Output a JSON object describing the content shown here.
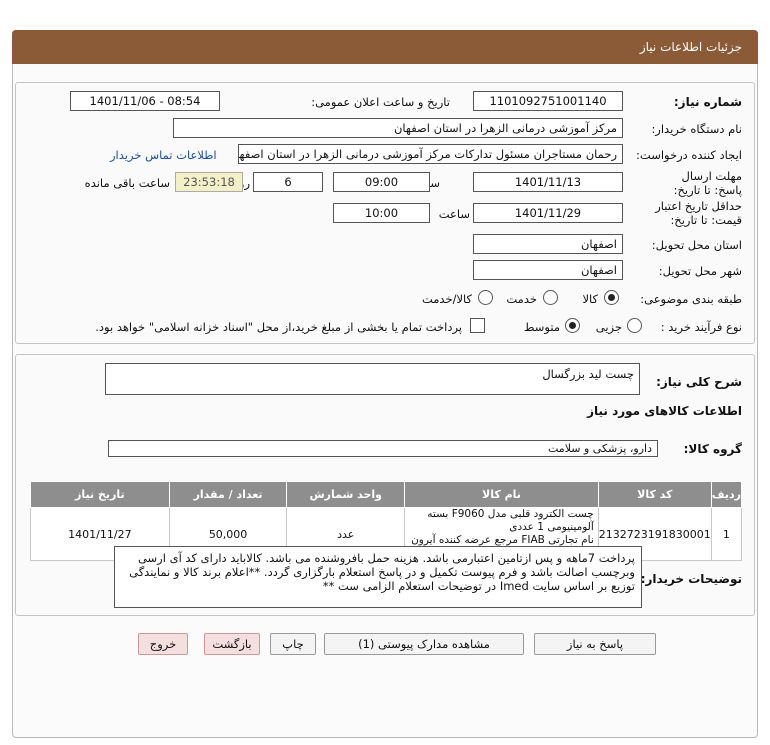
{
  "header": {
    "title": "جزئیات اطلاعات نیاز"
  },
  "form": {
    "need_number_label": "شماره نیاز:",
    "need_number_value": "1101092751001140",
    "announce_label": "تاریخ و ساعت اعلان عمومی:",
    "announce_value": "1401/11/06 - 08:54",
    "buyer_org_label": "نام دستگاه خریدار:",
    "buyer_org_value": "مرکز آموزشی درمانی الزهرا در استان اصفهان",
    "requester_label": "ایجاد کننده درخواست:",
    "requester_value": "رحمان مستاجران مسئول تداركات مرکز آموزشی درمانی الزهرا در استان اصفهان",
    "contact_link": "اطلاعات تماس خریدار",
    "deadline_label": "مهلت ارسال پاسخ: تا تاریخ:",
    "deadline_date": "1401/11/13",
    "time_label": "ساعت",
    "deadline_time": "09:00",
    "days_value": "6",
    "days_label": "روز و",
    "remaining_value": "23:53:18",
    "remaining_label": "ساعت باقی مانده",
    "validity_label": "حداقل تاریخ اعتبار قیمت: تا تاریخ:",
    "validity_date": "1401/11/29",
    "validity_time": "10:00",
    "province_label": "استان محل تحویل:",
    "province_value": "اصفهان",
    "city_label": "شهر محل تحویل:",
    "city_value": "اصفهان",
    "category_label": "طبقه بندی موضوعی:",
    "category_options": [
      "کالا",
      "خدمت",
      "کالا/خدمت"
    ],
    "category_selected": "کالا",
    "purchase_type_label": "نوع فرآیند خرید :",
    "purchase_options": [
      "جزیی",
      "متوسط"
    ],
    "purchase_selected": "متوسط",
    "payment_note": "پرداخت تمام یا بخشی از مبلغ خرید،از محل \"اسناد خزانه اسلامی\" خواهد بود."
  },
  "need": {
    "summary_label": "شرح کلی نیاز:",
    "summary_value": "چست لید بزرگسال",
    "goods_info_title": "اطلاعات کالاهای مورد نیاز",
    "goods_group_label": "گروه کالا:",
    "goods_group_value": "دارو، پزشکی و سلامت"
  },
  "table": {
    "headers": [
      "ردیف",
      "کد کالا",
      "نام کالا",
      "واحد شمارش",
      "تعداد / مقدار",
      "تاریخ نیاز"
    ],
    "rows": [
      {
        "index": "1",
        "code": "2132723191830001",
        "name_line1": "چست الکترود قلبی مدل F9060 بسته آلومینیومی 1 عددی",
        "name_line2": "نام تجارتی FIAB مرجع عرضه کننده آیرون نیلوفر",
        "unit": "عدد",
        "qty": "50,000",
        "date": "1401/11/27"
      }
    ]
  },
  "buyer_notes": {
    "label": "توضیحات خریدار:",
    "text": "پرداخت 7ماهه و پس ازتامین اعتبارمی باشد. هزینه حمل بافروشنده می باشد. کالاباید دارای کد آی ارسی وبرچسب اصالت باشد و فرم پیوست تکمیل و در پاسخ استعلام بارگزاری گردد. **اعلام برند کالا و نمایندگی توزیع بر اساس سایت Imed در توضیحات استعلام الزامی ست **"
  },
  "buttons": {
    "reply": "پاسخ به نیاز",
    "attachments": "مشاهده مدارک پیوستی (1)",
    "print": "چاپ",
    "back": "بازگشت",
    "exit": "خروج"
  }
}
